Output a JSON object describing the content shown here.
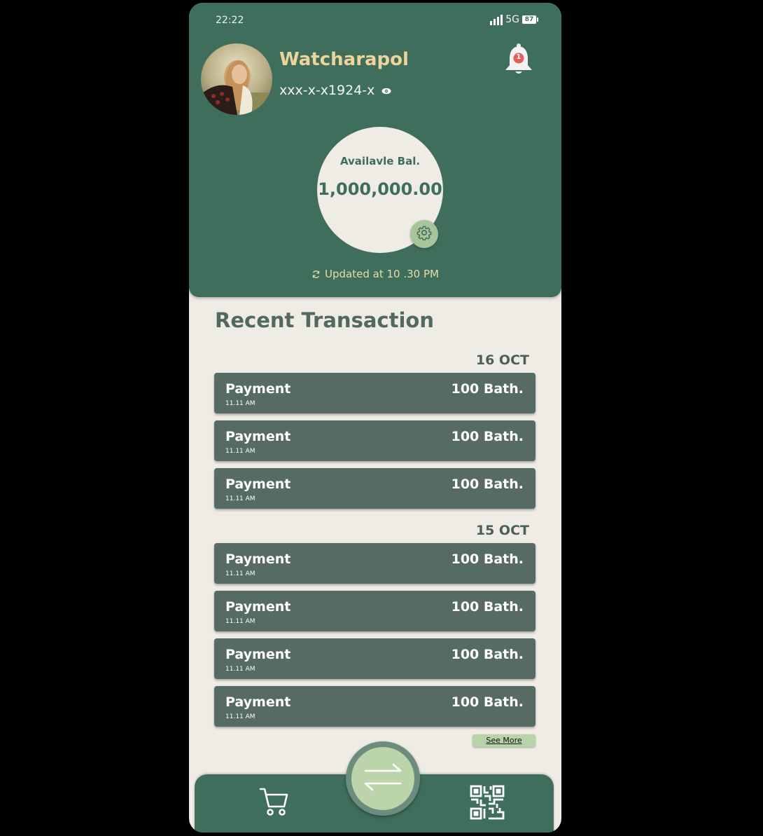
{
  "status_bar": {
    "time": "22:22",
    "network": "5G",
    "battery": "87"
  },
  "profile": {
    "name": "Watcharapol",
    "account": "xxx-x-x1924-x"
  },
  "notifications": {
    "count": "1"
  },
  "balance": {
    "label": "Availavle Bal.",
    "value": "1,000,000.00",
    "updated": "Updated at 10 .30 PM"
  },
  "transactions": {
    "title": "Recent Transaction",
    "groups": [
      {
        "date": "16 OCT",
        "items": [
          {
            "title": "Payment",
            "time": "11.11 AM",
            "amount": "100 Bath."
          },
          {
            "title": "Payment",
            "time": "11.11 AM",
            "amount": "100 Bath."
          },
          {
            "title": "Payment",
            "time": "11.11 AM",
            "amount": "100 Bath."
          }
        ]
      },
      {
        "date": "15 OCT",
        "items": [
          {
            "title": "Payment",
            "time": "11.11 AM",
            "amount": "100 Bath."
          },
          {
            "title": "Payment",
            "time": "11.11 AM",
            "amount": "100 Bath."
          },
          {
            "title": "Payment",
            "time": "11.11 AM",
            "amount": "100 Bath."
          },
          {
            "title": "Payment",
            "time": "11.11 AM",
            "amount": "100 Bath."
          }
        ]
      }
    ],
    "see_more": "See More"
  },
  "nav": {
    "left_icon": "cart-icon",
    "center_icon": "transfer-icon",
    "right_icon": "qr-code-icon"
  },
  "colors": {
    "primary": "#3f6e5d",
    "background": "#efece5",
    "accent_text": "#ecd49a",
    "card": "#566b63",
    "highlight": "#bcd4a9"
  }
}
